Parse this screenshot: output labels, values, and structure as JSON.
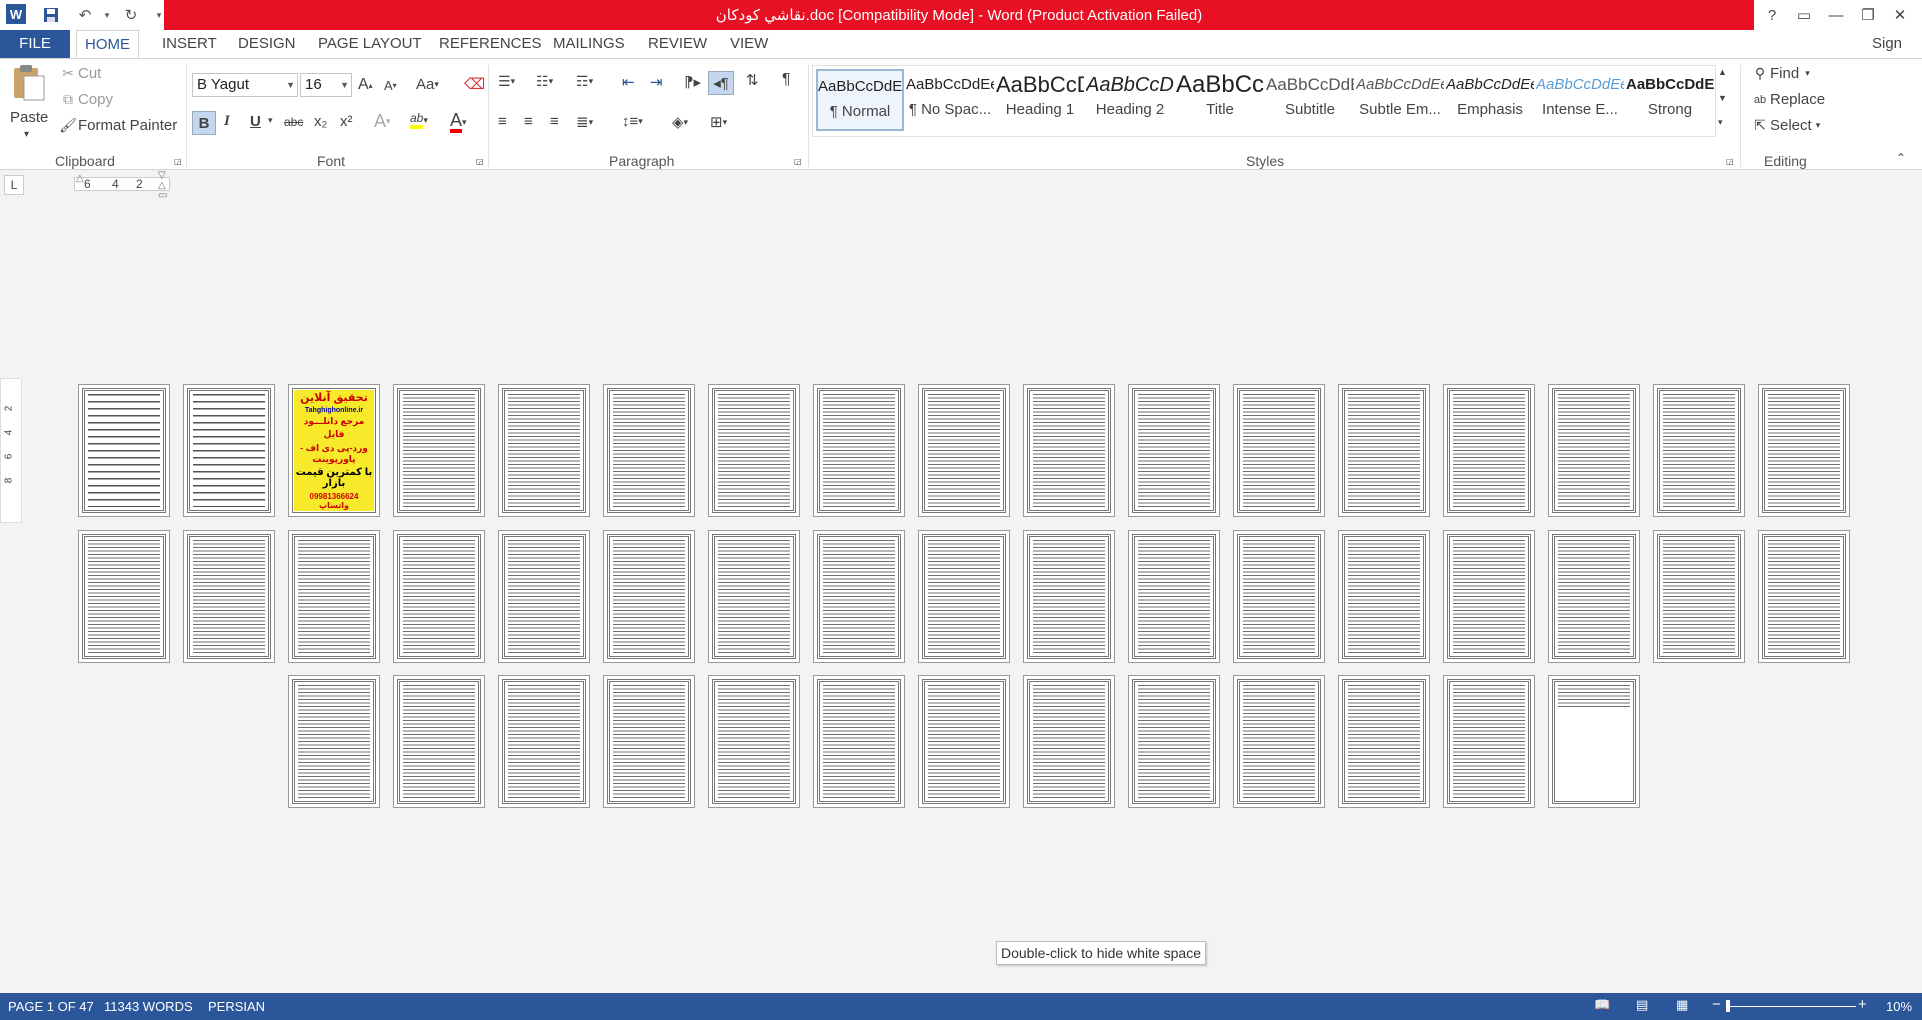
{
  "title_bar": {
    "title": "نقاشي كودكان.doc [Compatibility Mode] -  Word (Product Activation Failed)",
    "help": "?",
    "restore_ribbon": "▭",
    "minimize": "—",
    "maximize": "❐",
    "close": "✕"
  },
  "quick_access": {
    "app_icon": "W",
    "save": "💾",
    "undo": "↶",
    "redo": "↻",
    "customize": "▾"
  },
  "tabs": [
    {
      "label": "FILE"
    },
    {
      "label": "HOME"
    },
    {
      "label": "INSERT"
    },
    {
      "label": "DESIGN"
    },
    {
      "label": "PAGE LAYOUT"
    },
    {
      "label": "REFERENCES"
    },
    {
      "label": "MAILINGS"
    },
    {
      "label": "REVIEW"
    },
    {
      "label": "VIEW"
    }
  ],
  "sign_in": "Sign in",
  "clipboard": {
    "paste": "Paste",
    "cut": "Cut",
    "copy": "Copy",
    "format_painter": "Format Painter",
    "label": "Clipboard"
  },
  "font": {
    "name": "B Yagut",
    "size": "16",
    "label": "Font",
    "change_case": "Aa",
    "bold": "B",
    "italic": "I",
    "underline": "U",
    "strike": "abc",
    "sub": "x₂",
    "sup": "x²",
    "effects": "A",
    "highlight": "ab",
    "font_color": "A",
    "grow": "A",
    "shrink": "A"
  },
  "paragraph": {
    "label": "Paragraph",
    "pilcrow": "¶"
  },
  "styles": {
    "label": "Styles",
    "items": [
      {
        "preview": "AaBbCcDdEe",
        "name": "¶ Normal"
      },
      {
        "preview": "AaBbCcDdEe",
        "name": "¶ No Spac..."
      },
      {
        "preview": "AaBbCcDdEe",
        "name": "Heading 1"
      },
      {
        "preview": "AaBbCcDdEe",
        "name": "Heading 2"
      },
      {
        "preview": "AaBbCcDdEe",
        "name": "Title"
      },
      {
        "preview": "AaBbCcDdEe",
        "name": "Subtitle"
      },
      {
        "preview": "AaBbCcDdEe",
        "name": "Subtle Em..."
      },
      {
        "preview": "AaBbCcDdEe",
        "name": "Emphasis"
      },
      {
        "preview": "AaBbCcDdEe",
        "name": "Intense E..."
      },
      {
        "preview": "AaBbCcDdEe",
        "name": "Strong"
      }
    ]
  },
  "editing": {
    "label": "Editing",
    "find": "Find",
    "replace": "Replace",
    "select": "Select"
  },
  "ruler": {
    "marks": [
      "6",
      "4",
      "2"
    ],
    "vertical_marks": [
      "2",
      "4",
      "6",
      "8"
    ],
    "tab_stop": "L"
  },
  "ad_page": {
    "line1": "تحقیق آنلاین",
    "line2": "Tahghighonline.ir",
    "line3": "مرجع دانلـــود",
    "line4": "فایل",
    "line5": "ورد-پی دی اف - پاورپوینت",
    "line6": "با کمترین قیمت بازار",
    "line7": "09981366624 واتساپ"
  },
  "tooltip": "Double-click to hide white space",
  "status": {
    "page": "PAGE 1 OF 47",
    "words": "11343 WORDS",
    "language": "PERSIAN",
    "zoom": "10%"
  },
  "document": {
    "page_count": 47
  }
}
